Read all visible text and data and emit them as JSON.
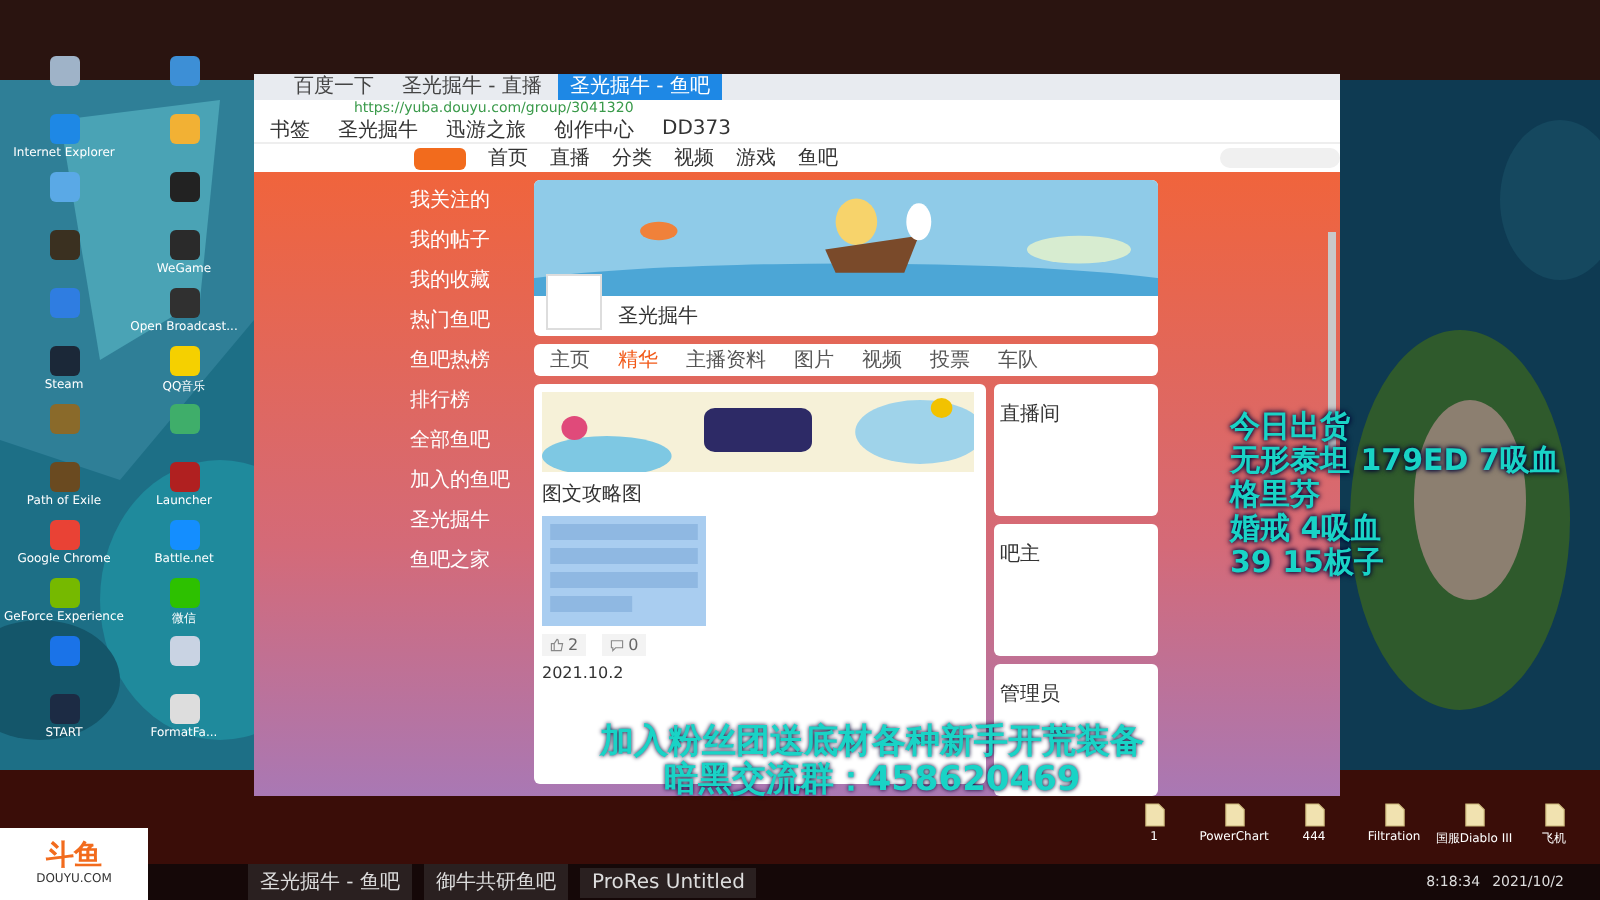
{
  "desktop_icons": [
    {
      "color": "#9fb3c8"
    },
    {
      "color": "#3d8fd6"
    },
    {
      "label": "Internet Explorer",
      "color": "#1e88e5"
    },
    {
      "color": "#f2b134"
    },
    {
      "color": "#5aa9e6"
    },
    {
      "color": "#222222"
    },
    {
      "color": "#3a3020"
    },
    {
      "label": "WeGame",
      "color": "#2a2a2a"
    },
    {
      "color": "#2f7de1"
    },
    {
      "label": "Open Broadcast...",
      "color": "#303030"
    },
    {
      "label": "Steam",
      "color": "#1b2838"
    },
    {
      "label": "QQ音乐",
      "color": "#f5d000"
    },
    {
      "color": "#8a6a2a"
    },
    {
      "color": "#3fae6a"
    },
    {
      "label": "Path of Exile",
      "color": "#6a4a20"
    },
    {
      "label": "Launcher",
      "color": "#b02020"
    },
    {
      "label": "Google Chrome",
      "color": "#e94235"
    },
    {
      "label": "Battle.net",
      "color": "#148eff"
    },
    {
      "label": "GeForce Experience",
      "color": "#76b900"
    },
    {
      "label": "微信",
      "color": "#2dc100"
    },
    {
      "color": "#1a73e8"
    },
    {
      "color": "#c9d3e3"
    },
    {
      "label": "START",
      "color": "#1c2b44"
    },
    {
      "label": "FormatFa...",
      "color": "#dddddd"
    }
  ],
  "browser": {
    "tabs": [
      {
        "label": "百度一下",
        "selected": false
      },
      {
        "label": "圣光掘牛 - 直播",
        "selected": false
      },
      {
        "label": "圣光掘牛 - 鱼吧",
        "selected": true
      }
    ],
    "url": "https://yuba.douyu.com/group/3041320",
    "bookmarks": [
      "书签",
      "圣光掘牛",
      "迅游之旅",
      "创作中心",
      "DD373"
    ]
  },
  "site": {
    "nav": [
      "首页",
      "直播",
      "分类",
      "视频",
      "游戏",
      "鱼吧"
    ],
    "sidebar": [
      "我关注的",
      "我的帖子",
      "我的收藏",
      "热门鱼吧",
      "鱼吧热榜",
      "排行榜",
      "全部鱼吧",
      "加入的鱼吧",
      "圣光掘牛",
      "鱼吧之家"
    ],
    "group_name": "圣光掘牛",
    "tabs": [
      {
        "label": "主页",
        "selected": false
      },
      {
        "label": "精华",
        "selected": true
      },
      {
        "label": "主播资料",
        "selected": false
      },
      {
        "label": "图片",
        "selected": false
      },
      {
        "label": "视频",
        "selected": false
      },
      {
        "label": "投票",
        "selected": false
      },
      {
        "label": "车队",
        "selected": false
      }
    ],
    "post_title": "图文攻略图",
    "likes": "2",
    "comments": "0",
    "date": "2021.10.2",
    "side_cards": [
      "直播间",
      "吧主",
      "管理员"
    ]
  },
  "overlay": {
    "today": [
      "今日出货",
      "无形泰坦 179ED 7吸血",
      "格里芬",
      "婚戒 4吸血",
      "39 15板子"
    ],
    "promo": [
      "加入粉丝团送底材各种新手开荒装备",
      "暗黑交流群：458620469"
    ],
    "logo": "斗鱼",
    "logo_site": "DOUYU.COM"
  },
  "right_icons": [
    "1",
    "PowerChart",
    "444",
    "Filtration",
    "国服Diablo III",
    "飞机"
  ],
  "taskbar": {
    "items": [
      "圣光掘牛 - 鱼吧",
      "御牛共研鱼吧",
      "ProRes Untitled"
    ],
    "time": "8:18:34",
    "date": "2021/10/2"
  }
}
